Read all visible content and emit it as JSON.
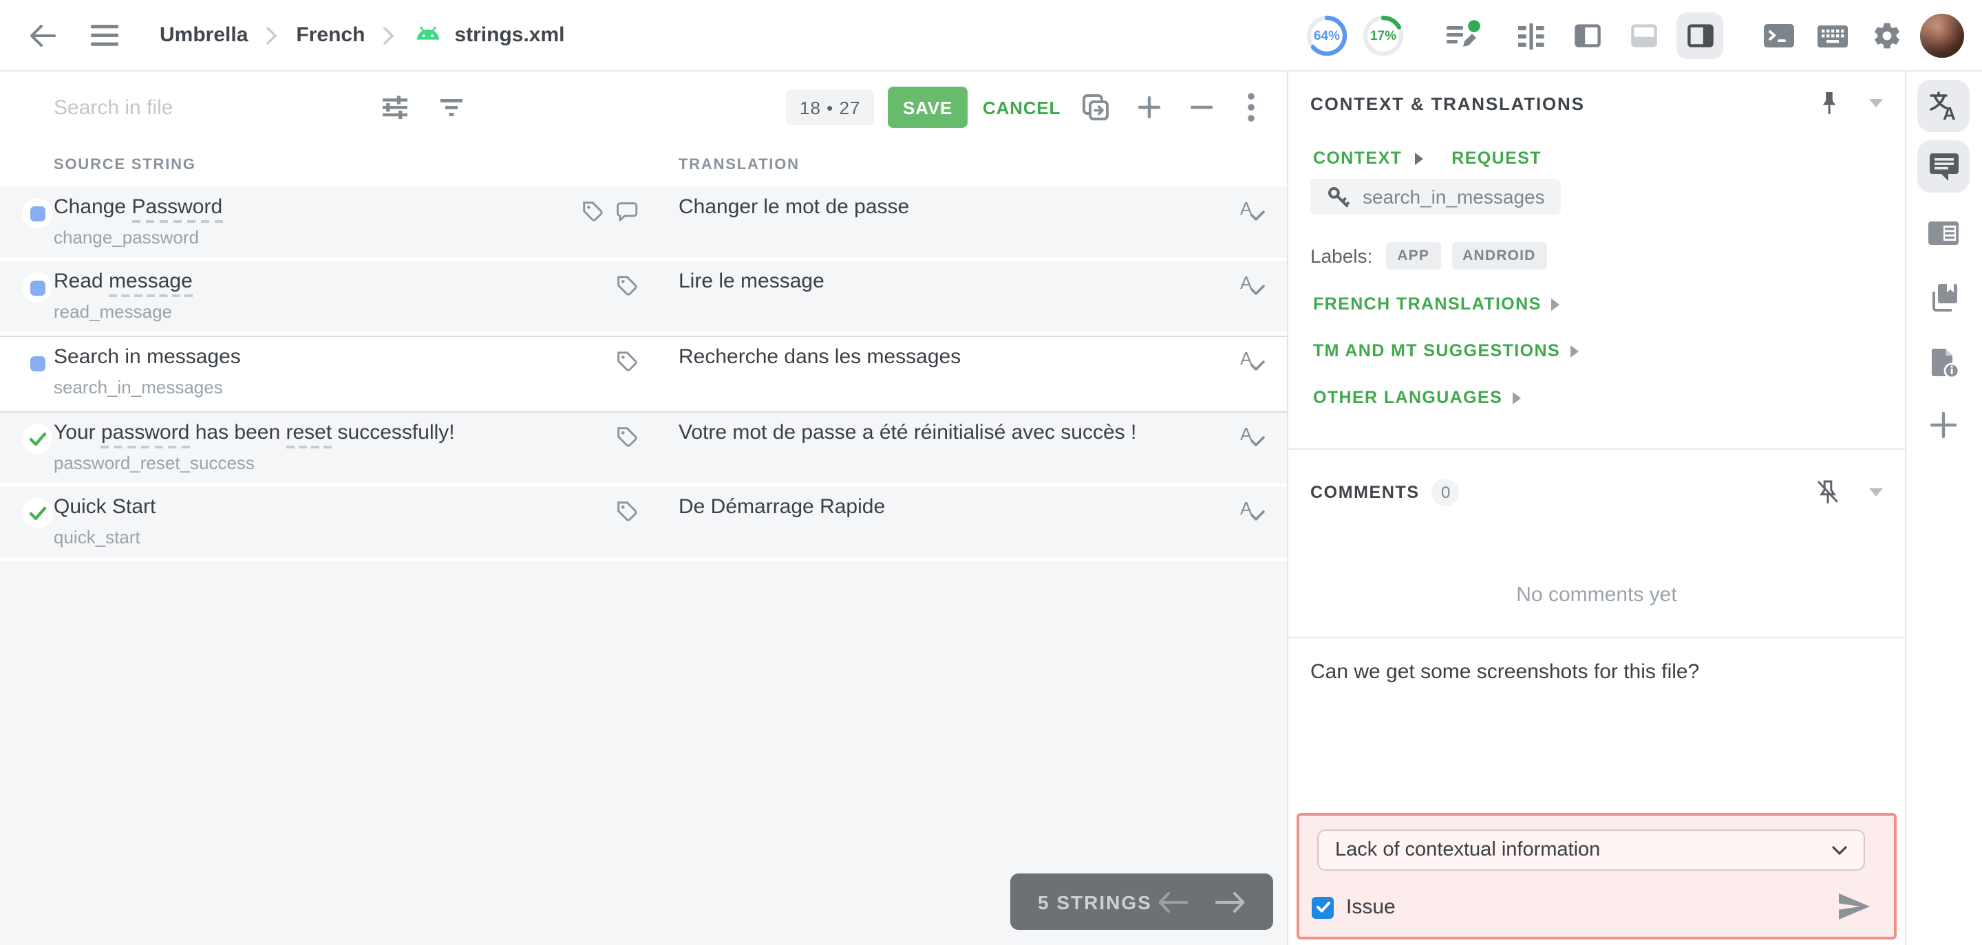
{
  "topbar": {
    "breadcrumb": [
      "Umbrella",
      "French",
      "strings.xml"
    ],
    "progress": [
      {
        "value": "64%",
        "percent": 64,
        "color": "#5b96f2"
      },
      {
        "value": "17%",
        "percent": 17,
        "color": "#34a853"
      }
    ]
  },
  "toolbar": {
    "search_placeholder": "Search in file",
    "counter": "18 • 27",
    "save_label": "SAVE",
    "cancel_label": "CANCEL"
  },
  "table": {
    "headers": {
      "source": "SOURCE STRING",
      "translation": "TRANSLATION"
    },
    "rows": [
      {
        "status": "translated",
        "selected": false,
        "source_parts": [
          {
            "t": "Change ",
            "u": false
          },
          {
            "t": "Password",
            "u": true
          }
        ],
        "key": "change_password",
        "icons": [
          "tag",
          "comment"
        ],
        "translation": "Changer le mot de passe"
      },
      {
        "status": "translated",
        "selected": false,
        "source_parts": [
          {
            "t": "Read ",
            "u": false
          },
          {
            "t": "message",
            "u": true
          }
        ],
        "key": "read_message",
        "icons": [
          "tag"
        ],
        "translation": "Lire le message"
      },
      {
        "status": "translated",
        "selected": true,
        "source_parts": [
          {
            "t": "Search in messages",
            "u": false
          }
        ],
        "key": "search_in_messages",
        "icons": [
          "tag"
        ],
        "translation": "Recherche dans les messages"
      },
      {
        "status": "approved",
        "selected": false,
        "source_parts": [
          {
            "t": "Your ",
            "u": false
          },
          {
            "t": "password",
            "u": true
          },
          {
            "t": " has been ",
            "u": false
          },
          {
            "t": "reset",
            "u": true
          },
          {
            "t": " successfully!",
            "u": false
          }
        ],
        "key": "password_reset_success",
        "icons": [
          "tag"
        ],
        "translation": "Votre mot de passe a été réinitialisé avec succès !"
      },
      {
        "status": "approved",
        "selected": false,
        "source_parts": [
          {
            "t": "Quick Start",
            "u": false
          }
        ],
        "key": "quick_start",
        "icons": [
          "tag"
        ],
        "translation": "De Démarrage Rapide"
      }
    ]
  },
  "footer": {
    "strings_label": "5 STRINGS"
  },
  "context_panel": {
    "title": "CONTEXT & TRANSLATIONS",
    "tabs": {
      "context": "CONTEXT",
      "request": "REQUEST"
    },
    "string_key": "search_in_messages",
    "labels_caption": "Labels:",
    "labels": [
      "APP",
      "ANDROID"
    ],
    "sections": [
      "FRENCH TRANSLATIONS",
      "TM AND MT SUGGESTIONS",
      "OTHER LANGUAGES"
    ],
    "comments": {
      "title": "COMMENTS",
      "count": "0",
      "empty": "No comments yet",
      "draft": "Can we get some screenshots for this file?"
    },
    "issue_box": {
      "selected_option": "Lack of contextual information",
      "checkbox_label": "Issue",
      "checked": true
    }
  },
  "colors": {
    "accent_green": "#3fa94c",
    "save_green": "#68bb6c",
    "status_blue": "#88adf2",
    "status_green": "#4caf50",
    "issue_border": "#f0908a",
    "issue_bg": "#fdecec",
    "checkbox_blue": "#1e88e5"
  }
}
